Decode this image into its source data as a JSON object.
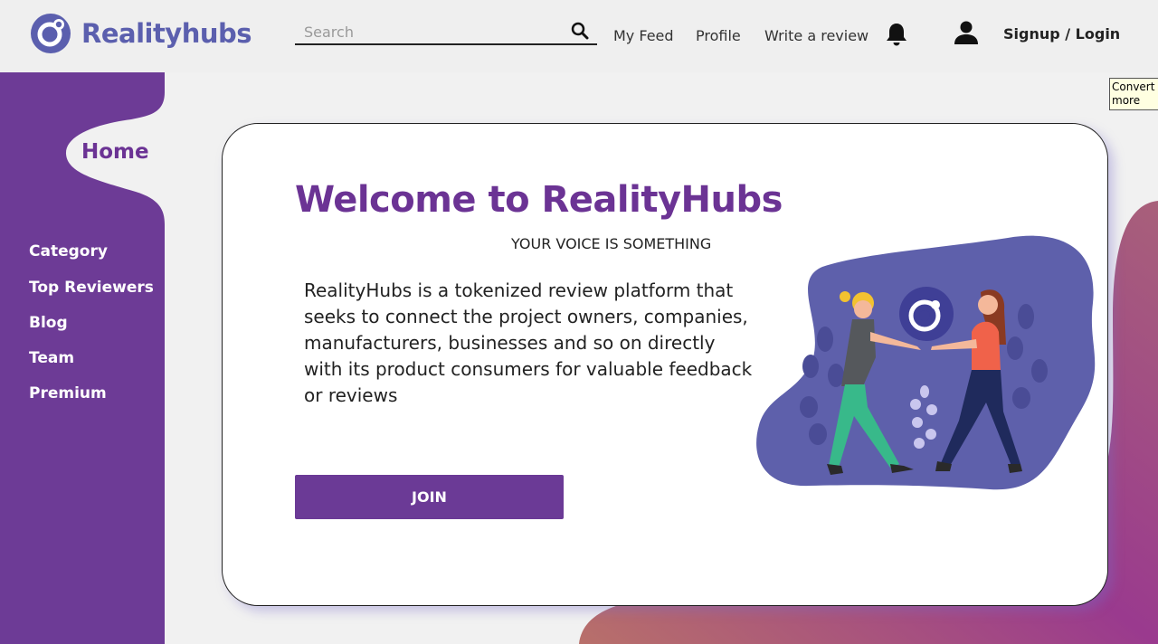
{
  "brand": {
    "name": "Realityhubs",
    "color": "#5b5fae"
  },
  "header": {
    "search": {
      "placeholder": "Search",
      "value": ""
    },
    "nav": [
      "My Feed",
      "Profile",
      "Write a review"
    ],
    "signup_label": "Signup / Login",
    "icons": [
      "search-icon",
      "bell-icon",
      "user-icon"
    ]
  },
  "tooltip": {
    "line1": "Convert a",
    "line2": "more"
  },
  "sidebar": {
    "active": "Home",
    "items": [
      "Category",
      "Top Reviewers",
      "Blog",
      "Team",
      "Premium"
    ],
    "color": "#6d3b96"
  },
  "main": {
    "title": "Welcome to RealityHubs",
    "tagline": "YOUR VOICE IS SOMETHING",
    "description": "RealityHubs is a tokenized review platform that seeks to connect the project owners,  companies, manufacturers, businesses and so on directly with its product consumers for valuable feedback or reviews",
    "join_label": "JOIN",
    "accent": "#6b3394"
  }
}
